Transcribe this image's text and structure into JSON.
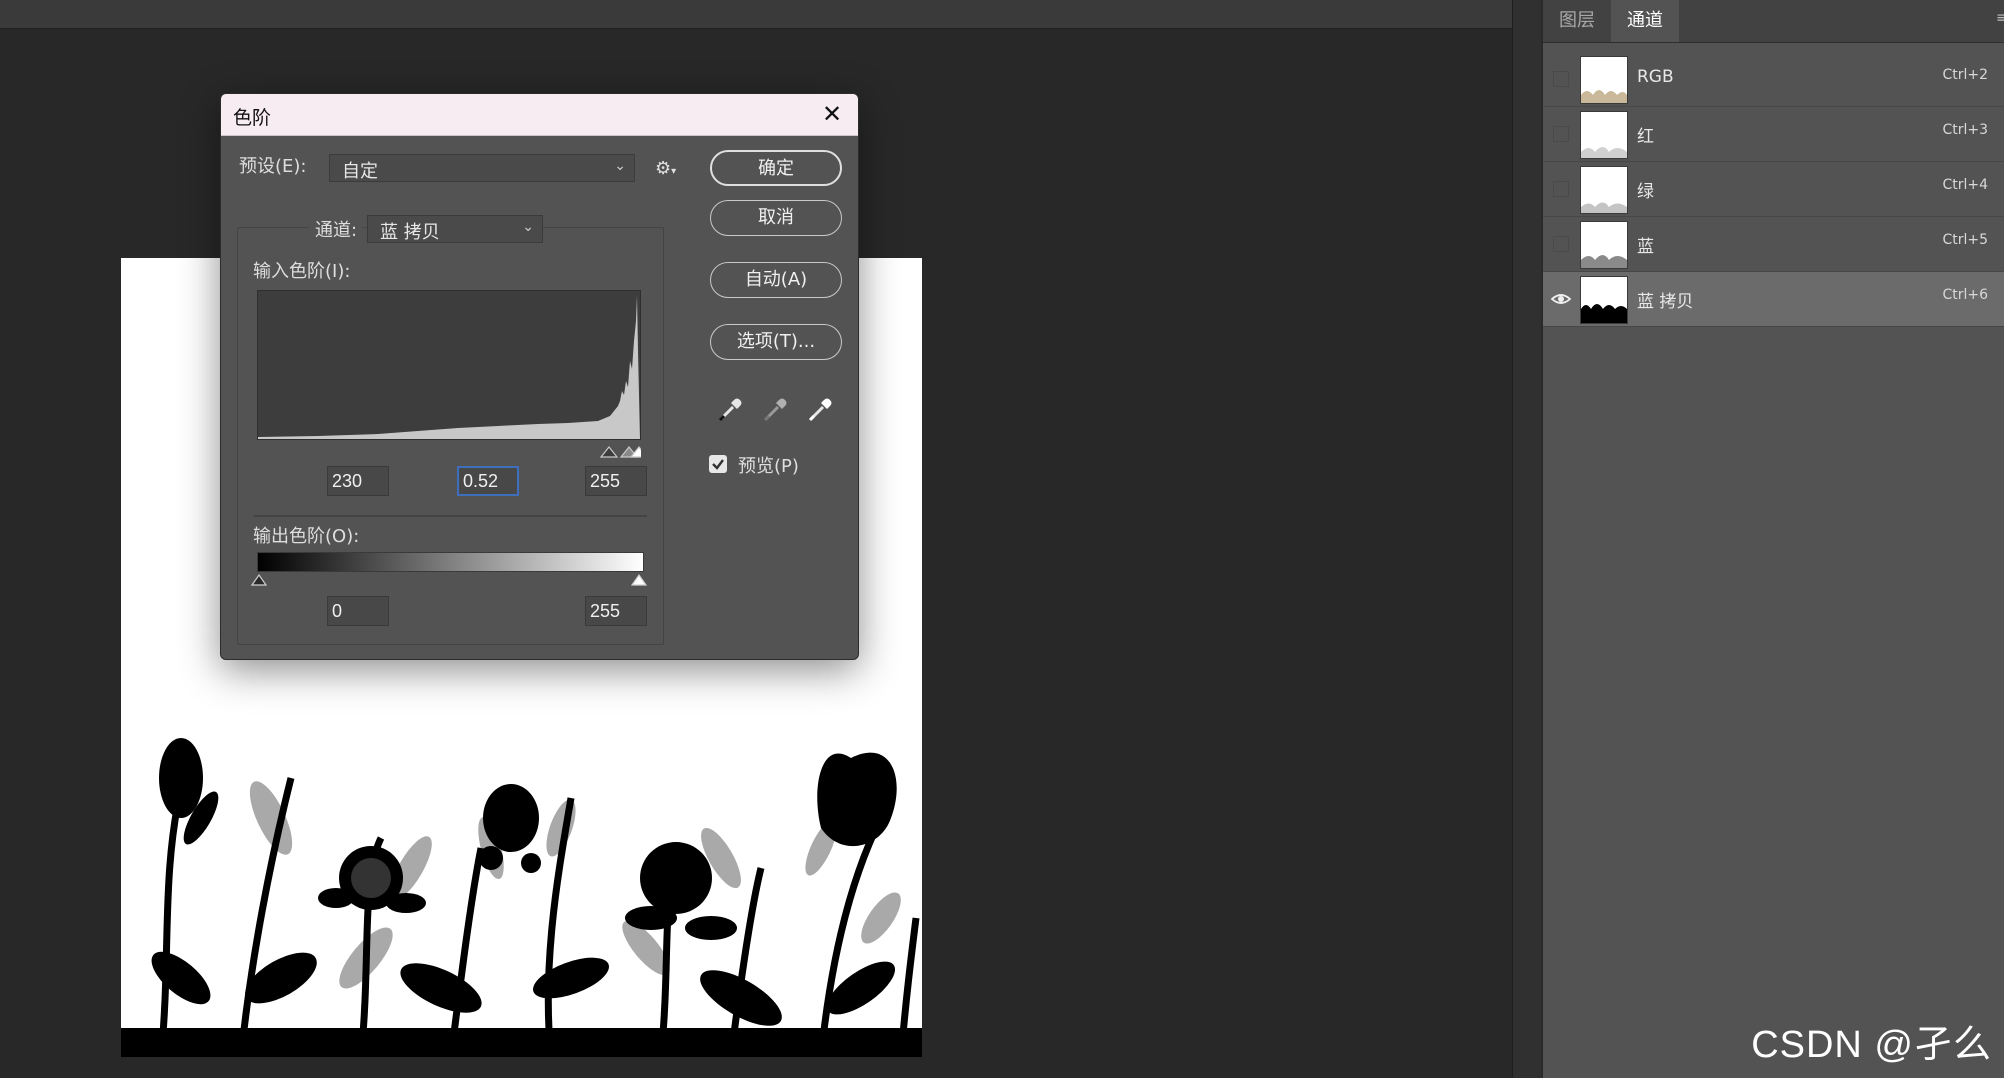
{
  "panel": {
    "tabs": [
      {
        "label": "图层",
        "active": false
      },
      {
        "label": "通道",
        "active": true
      }
    ],
    "channels": [
      {
        "name": "RGB",
        "shortcut": "Ctrl+2",
        "visible": false,
        "selected": false
      },
      {
        "name": "红",
        "shortcut": "Ctrl+3",
        "visible": false,
        "selected": false
      },
      {
        "name": "绿",
        "shortcut": "Ctrl+4",
        "visible": false,
        "selected": false
      },
      {
        "name": "蓝",
        "shortcut": "Ctrl+5",
        "visible": false,
        "selected": false
      },
      {
        "name": "蓝 拷贝",
        "shortcut": "Ctrl+6",
        "visible": true,
        "selected": true
      }
    ]
  },
  "dialog": {
    "title": "色阶",
    "preset_label": "预设(E):",
    "preset_value": "自定",
    "channel_label": "通道:",
    "channel_value": "蓝 拷贝",
    "input_levels_label": "输入色阶(I):",
    "input_black": "230",
    "input_gamma": "0.52",
    "input_white": "255",
    "output_levels_label": "输出色阶(O):",
    "output_black": "0",
    "output_white": "255",
    "buttons": {
      "ok": "确定",
      "cancel": "取消",
      "auto": "自动(A)",
      "options": "选项(T)..."
    },
    "preview_label": "预览(P)",
    "preview_checked": true
  },
  "watermark": "CSDN @孑么",
  "colors": {
    "dialog_title_bg": "#f7ecf2",
    "panel_bg": "#535353",
    "canvas_bg": "#282828",
    "focus_border": "#3e6fbd"
  }
}
